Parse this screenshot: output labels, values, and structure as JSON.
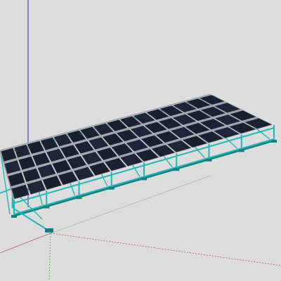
{
  "scene": {
    "background_color": "#dddddd",
    "axis_colors": {
      "vertical": "#2a2aa0",
      "red": "#c05050",
      "green": "#4aa04a"
    },
    "panel_color": "#1a2132",
    "panel_edge_color": "#7d8590",
    "frame_color": "#1fb8ba",
    "frame_dark_color": "#12807f",
    "panel_grid": {
      "columns": 16,
      "rows": 4
    }
  }
}
